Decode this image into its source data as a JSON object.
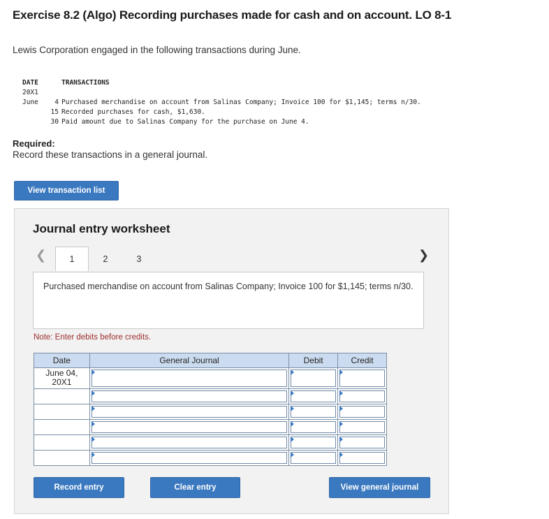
{
  "header": {
    "title": "Exercise 8.2 (Algo) Recording purchases made for cash and on account. LO 8-1",
    "intro": "Lewis Corporation engaged in the following transactions during June."
  },
  "transactions": {
    "col_date": "DATE",
    "col_transactions": "TRANSACTIONS",
    "year": "20X1",
    "month": "June",
    "rows": [
      {
        "day": "4",
        "text": "Purchased merchandise on account from Salinas Company; Invoice 100 for $1,145; terms n/30."
      },
      {
        "day": "15",
        "text": "Recorded purchases for cash, $1,630."
      },
      {
        "day": "30",
        "text": "Paid amount due to Salinas Company for the purchase on June 4."
      }
    ]
  },
  "required": {
    "label": "Required:",
    "text": "Record these transactions in a general journal."
  },
  "buttons": {
    "view_transaction_list": "View transaction list",
    "record_entry": "Record entry",
    "clear_entry": "Clear entry",
    "view_general_journal": "View general journal"
  },
  "worksheet": {
    "title": "Journal entry worksheet",
    "tabs": [
      "1",
      "2",
      "3"
    ],
    "active_tab": 0,
    "description": "Purchased merchandise on account from Salinas Company; Invoice 100 for $1,145; terms n/30.",
    "note": "Note: Enter debits before credits.",
    "columns": {
      "date": "Date",
      "general_journal": "General Journal",
      "debit": "Debit",
      "credit": "Credit"
    },
    "entry_date_line1": "June 04,",
    "entry_date_line2": "20X1"
  },
  "icons": {
    "prev": "chevron-left-icon",
    "next": "chevron-right-icon"
  },
  "colors": {
    "button": "#3a78bf",
    "table_header": "#ccdcf0",
    "note": "#9b2c2c"
  }
}
